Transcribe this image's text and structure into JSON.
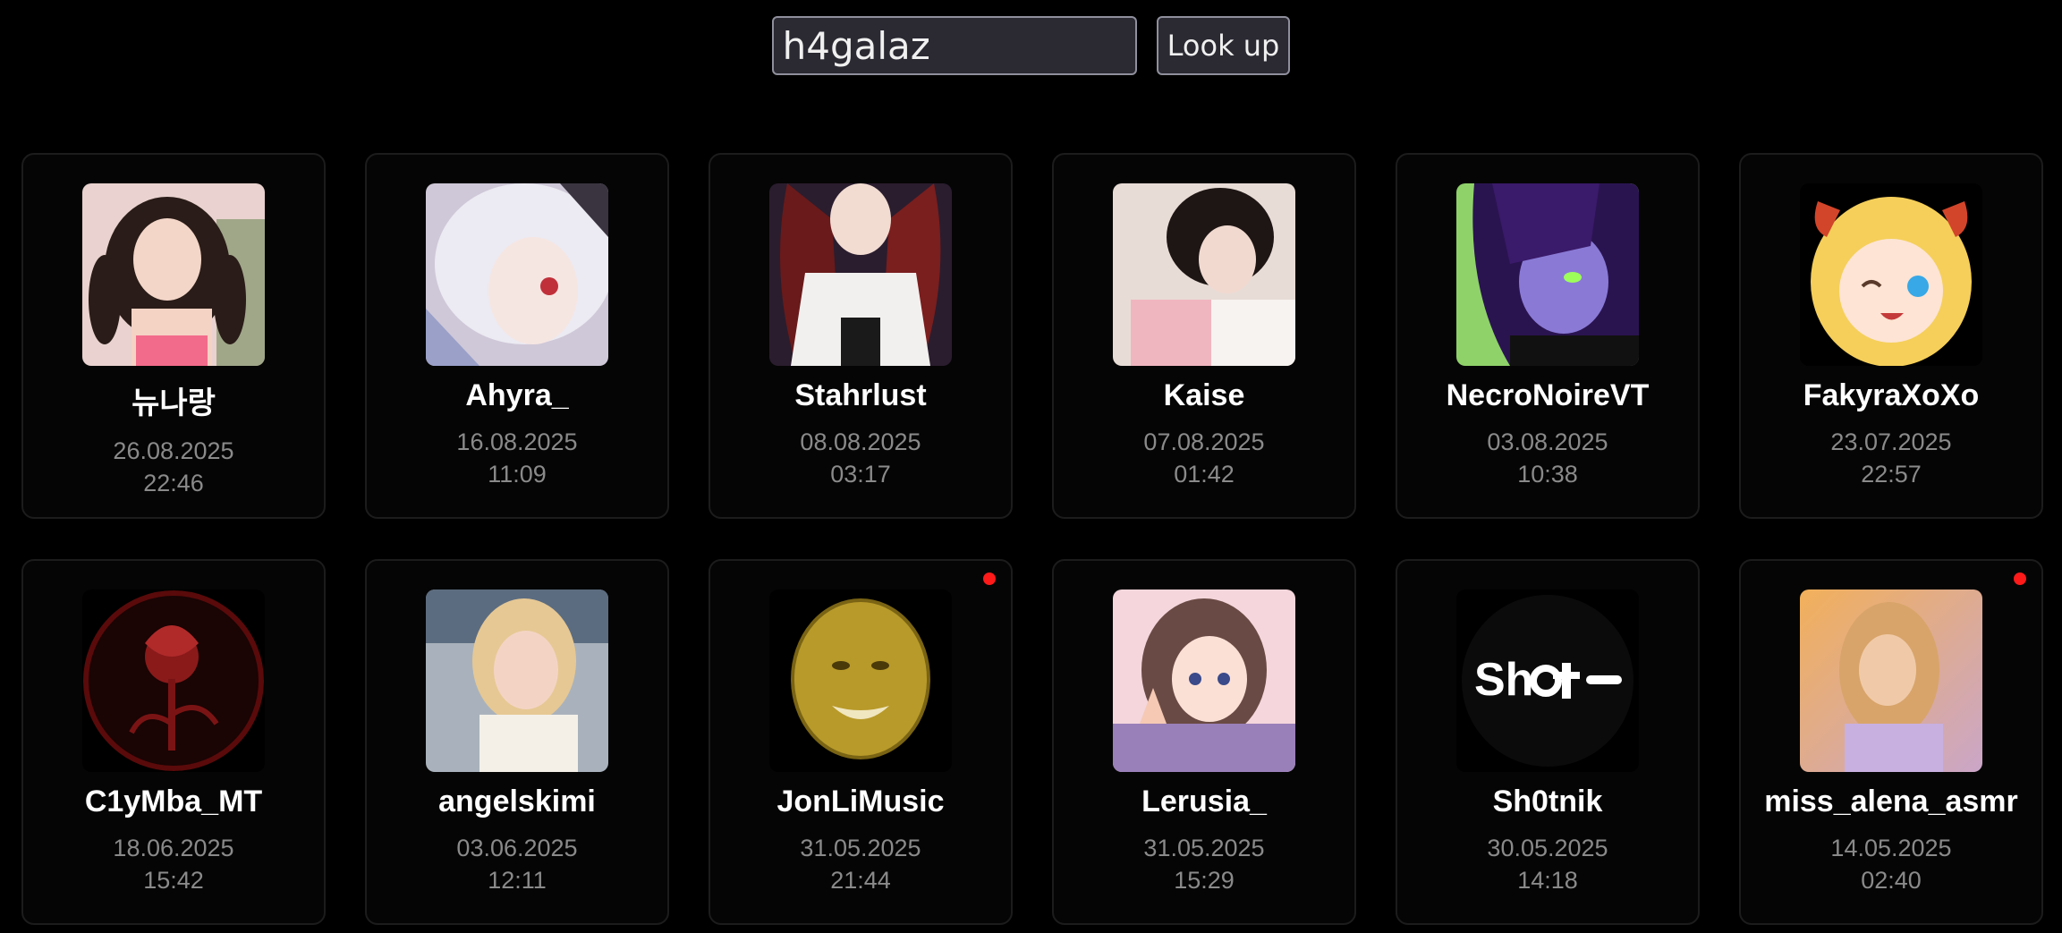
{
  "search": {
    "value": "h4galaz",
    "button_label": "Look up"
  },
  "colors": {
    "background": "#000000",
    "live_dot": "#ff1a1a",
    "date_text": "#8a8a8a"
  },
  "cards": [
    {
      "name": "뉴나랑",
      "date": "26.08.2025",
      "time": "22:46",
      "live": false,
      "avatar": "photo-girl-pink-top"
    },
    {
      "name": "Ahyra_",
      "date": "16.08.2025",
      "time": "11:09",
      "live": false,
      "avatar": "anime-white-hair"
    },
    {
      "name": "Stahrlust",
      "date": "08.08.2025",
      "time": "03:17",
      "live": false,
      "avatar": "anime-red-hair"
    },
    {
      "name": "Kaise",
      "date": "07.08.2025",
      "time": "01:42",
      "live": false,
      "avatar": "photo-girl-lying"
    },
    {
      "name": "NecroNoireVT",
      "date": "03.08.2025",
      "time": "10:38",
      "live": false,
      "avatar": "vtuber-purple"
    },
    {
      "name": "FakyraXoXo",
      "date": "23.07.2025",
      "time": "22:57",
      "live": false,
      "avatar": "anime-blonde-horns"
    },
    {
      "name": "C1yMba_MT",
      "date": "18.06.2025",
      "time": "15:42",
      "live": false,
      "avatar": "red-rose"
    },
    {
      "name": "angelskimi",
      "date": "03.06.2025",
      "time": "12:11",
      "live": false,
      "avatar": "photo-blonde-girl"
    },
    {
      "name": "JonLiMusic",
      "date": "31.05.2025",
      "time": "21:44",
      "live": true,
      "avatar": "golden-face"
    },
    {
      "name": "Lerusia_",
      "date": "31.05.2025",
      "time": "15:29",
      "live": false,
      "avatar": "anime-brown-hair"
    },
    {
      "name": "Sh0tnik",
      "date": "30.05.2025",
      "time": "14:18",
      "live": false,
      "avatar": "shot-logo"
    },
    {
      "name": "miss_alena_asmr",
      "date": "14.05.2025",
      "time": "02:40",
      "live": true,
      "avatar": "photo-sunset-girl"
    }
  ]
}
